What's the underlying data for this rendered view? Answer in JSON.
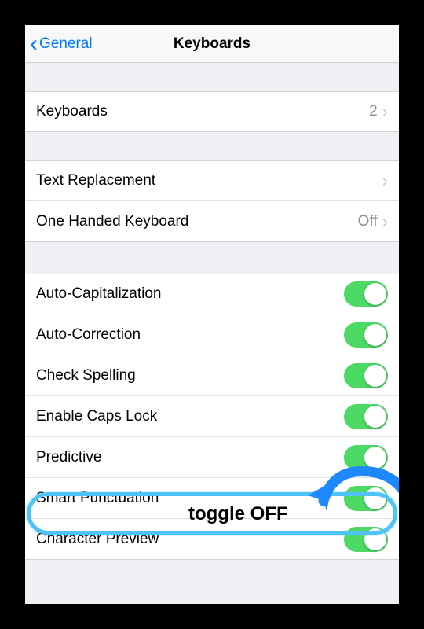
{
  "nav": {
    "back_label": "General",
    "title": "Keyboards"
  },
  "rows": {
    "keyboards": {
      "label": "Keyboards",
      "value": "2"
    },
    "text_replacement": {
      "label": "Text Replacement"
    },
    "one_handed": {
      "label": "One Handed Keyboard",
      "value": "Off"
    },
    "auto_cap": {
      "label": "Auto-Capitalization",
      "on": true
    },
    "auto_corr": {
      "label": "Auto-Correction",
      "on": true
    },
    "check_spell": {
      "label": "Check Spelling",
      "on": true
    },
    "caps_lock": {
      "label": "Enable Caps Lock",
      "on": true
    },
    "predictive": {
      "label": "Predictive",
      "on": true
    },
    "smart_punc": {
      "label": "Smart Punctuation",
      "on": true
    },
    "char_preview": {
      "label": "Character Preview",
      "on": true
    }
  },
  "annotation": {
    "text": "toggle OFF"
  },
  "colors": {
    "link": "#007aff",
    "toggle_on": "#4cd964",
    "highlight": "#4fc3f7",
    "arrow": "#1e88ff"
  }
}
